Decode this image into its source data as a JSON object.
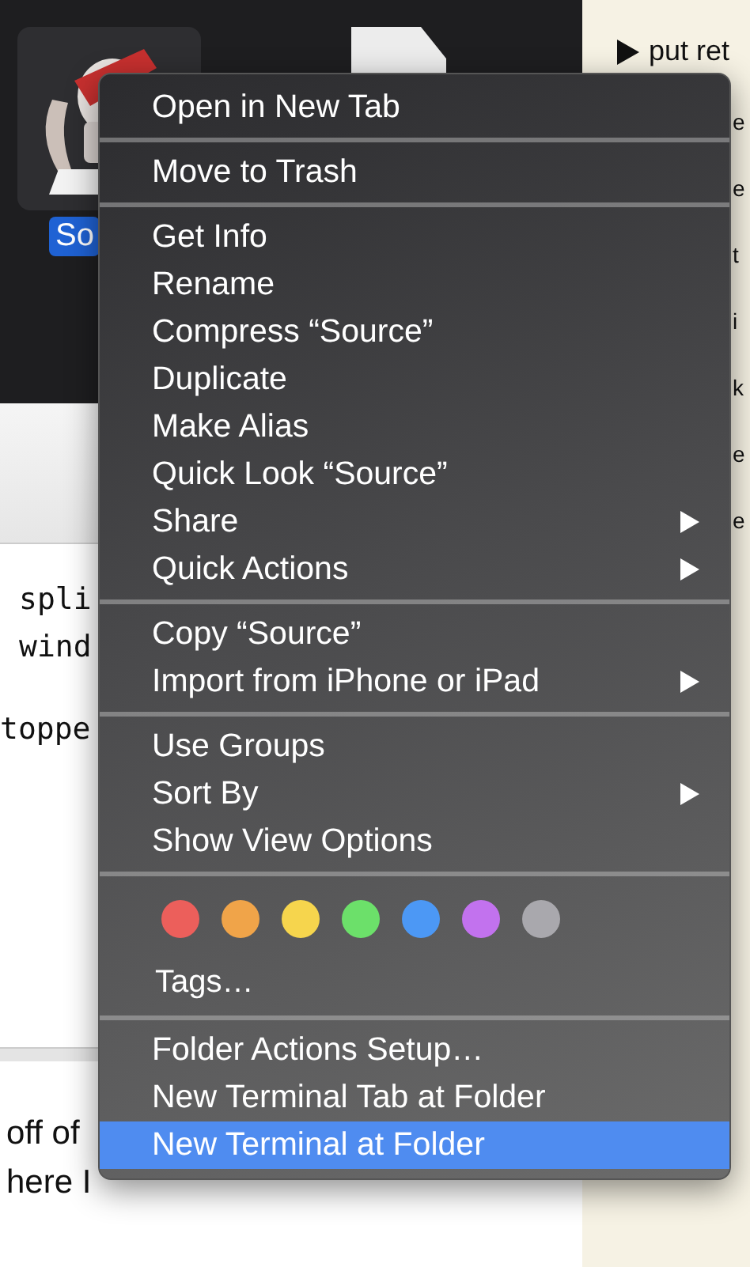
{
  "finder": {
    "file_label": "So",
    "file_selected": true
  },
  "side_panel": {
    "lines": [
      {
        "kind": "bullet",
        "text": "put ret"
      },
      {
        "kind": "fragment",
        "text": "e"
      },
      {
        "kind": "fragment",
        "text": "e"
      },
      {
        "kind": "fragment",
        "text": "t"
      },
      {
        "kind": "fragment",
        "text": "i"
      },
      {
        "kind": "fragment",
        "text": "k"
      },
      {
        "kind": "fragment",
        "text": "e"
      },
      {
        "kind": "fragment",
        "text": "e"
      }
    ]
  },
  "editor": {
    "code_blocks": [
      [
        "spli",
        "wind"
      ],
      [
        "toppe"
      ]
    ],
    "text_lines": [
      "off of",
      "here I"
    ]
  },
  "menu": {
    "sections": [
      {
        "kind": "items",
        "items": [
          {
            "label": "Open in New Tab",
            "submenu": false,
            "selected": false
          }
        ]
      },
      {
        "kind": "items",
        "items": [
          {
            "label": "Move to Trash",
            "submenu": false,
            "selected": false
          }
        ]
      },
      {
        "kind": "items",
        "items": [
          {
            "label": "Get Info",
            "submenu": false,
            "selected": false
          },
          {
            "label": "Rename",
            "submenu": false,
            "selected": false
          },
          {
            "label": "Compress “Source”",
            "submenu": false,
            "selected": false
          },
          {
            "label": "Duplicate",
            "submenu": false,
            "selected": false
          },
          {
            "label": "Make Alias",
            "submenu": false,
            "selected": false
          },
          {
            "label": "Quick Look “Source”",
            "submenu": false,
            "selected": false
          },
          {
            "label": "Share",
            "submenu": true,
            "selected": false
          },
          {
            "label": "Quick Actions",
            "submenu": true,
            "selected": false
          }
        ]
      },
      {
        "kind": "items",
        "items": [
          {
            "label": "Copy “Source”",
            "submenu": false,
            "selected": false
          },
          {
            "label": "Import from iPhone or iPad",
            "submenu": true,
            "selected": false
          }
        ]
      },
      {
        "kind": "items",
        "items": [
          {
            "label": "Use Groups",
            "submenu": false,
            "selected": false
          },
          {
            "label": "Sort By",
            "submenu": true,
            "selected": false
          },
          {
            "label": "Show View Options",
            "submenu": false,
            "selected": false
          }
        ]
      },
      {
        "kind": "tags",
        "colors": [
          {
            "color": "#ec5f5b"
          },
          {
            "color": "#f0a449"
          },
          {
            "color": "#f6d54d"
          },
          {
            "color": "#6ce06a"
          },
          {
            "color": "#4c98f5"
          },
          {
            "color": "#c272ee"
          },
          {
            "color": "#a9a8ad"
          }
        ],
        "label": "Tags…"
      },
      {
        "kind": "items",
        "items": [
          {
            "label": "Folder Actions Setup…",
            "submenu": false,
            "selected": false
          },
          {
            "label": "New Terminal Tab at Folder",
            "submenu": false,
            "selected": false
          },
          {
            "label": "New Terminal at Folder",
            "submenu": false,
            "selected": true
          }
        ]
      }
    ]
  }
}
